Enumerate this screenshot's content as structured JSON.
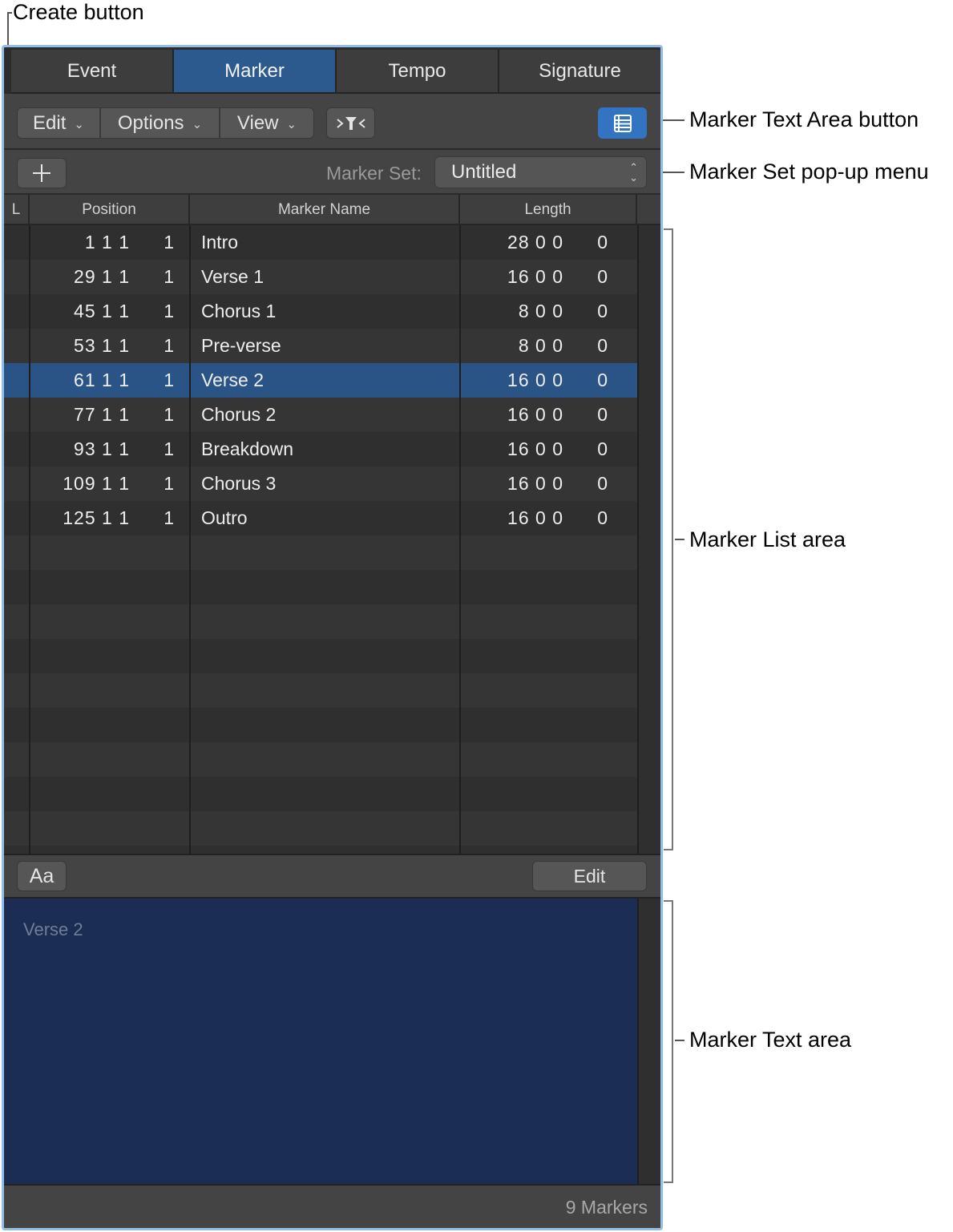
{
  "callouts": {
    "create_button": "Create button",
    "text_area_button": "Marker Text Area button",
    "set_popup": "Marker Set pop-up menu",
    "list_area": "Marker List area",
    "text_area": "Marker Text area"
  },
  "tabs": [
    {
      "label": "Event",
      "active": false
    },
    {
      "label": "Marker",
      "active": true
    },
    {
      "label": "Tempo",
      "active": false
    },
    {
      "label": "Signature",
      "active": false
    }
  ],
  "toolbar": {
    "edit_label": "Edit",
    "options_label": "Options",
    "view_label": "View",
    "filter_icon": "catch-filter-icon",
    "text_area_icon": "list-icon"
  },
  "marker_set": {
    "label": "Marker Set:",
    "value": "Untitled"
  },
  "columns": {
    "lock": "L",
    "position": "Position",
    "name": "Marker Name",
    "length": "Length"
  },
  "rows": [
    {
      "pos": "1 1 1",
      "pos_tick": "1",
      "name": "Intro",
      "len": "28 0 0",
      "len_tick": "0",
      "selected": false
    },
    {
      "pos": "29 1 1",
      "pos_tick": "1",
      "name": "Verse 1",
      "len": "16 0 0",
      "len_tick": "0",
      "selected": false
    },
    {
      "pos": "45 1 1",
      "pos_tick": "1",
      "name": "Chorus 1",
      "len": "8 0 0",
      "len_tick": "0",
      "selected": false
    },
    {
      "pos": "53 1 1",
      "pos_tick": "1",
      "name": "Pre-verse",
      "len": "8 0 0",
      "len_tick": "0",
      "selected": false
    },
    {
      "pos": "61 1 1",
      "pos_tick": "1",
      "name": "Verse 2",
      "len": "16 0 0",
      "len_tick": "0",
      "selected": true
    },
    {
      "pos": "77 1 1",
      "pos_tick": "1",
      "name": "Chorus 2",
      "len": "16 0 0",
      "len_tick": "0",
      "selected": false
    },
    {
      "pos": "93 1 1",
      "pos_tick": "1",
      "name": "Breakdown",
      "len": "16 0 0",
      "len_tick": "0",
      "selected": false
    },
    {
      "pos": "109 1 1",
      "pos_tick": "1",
      "name": "Chorus 3",
      "len": "16 0 0",
      "len_tick": "0",
      "selected": false
    },
    {
      "pos": "125 1 1",
      "pos_tick": "1",
      "name": "Outro",
      "len": "16 0 0",
      "len_tick": "0",
      "selected": false
    }
  ],
  "midbar": {
    "font_button": "Aa",
    "edit_button": "Edit"
  },
  "text_area": {
    "content": "Verse 2"
  },
  "status": {
    "count": "9 Markers"
  },
  "colors": {
    "accent": "#3374c2",
    "selected_row": "#2b5486",
    "active_tab": "#2d5a8e",
    "text_area_bg": "#1b2d52",
    "window_border": "#93bde9"
  }
}
